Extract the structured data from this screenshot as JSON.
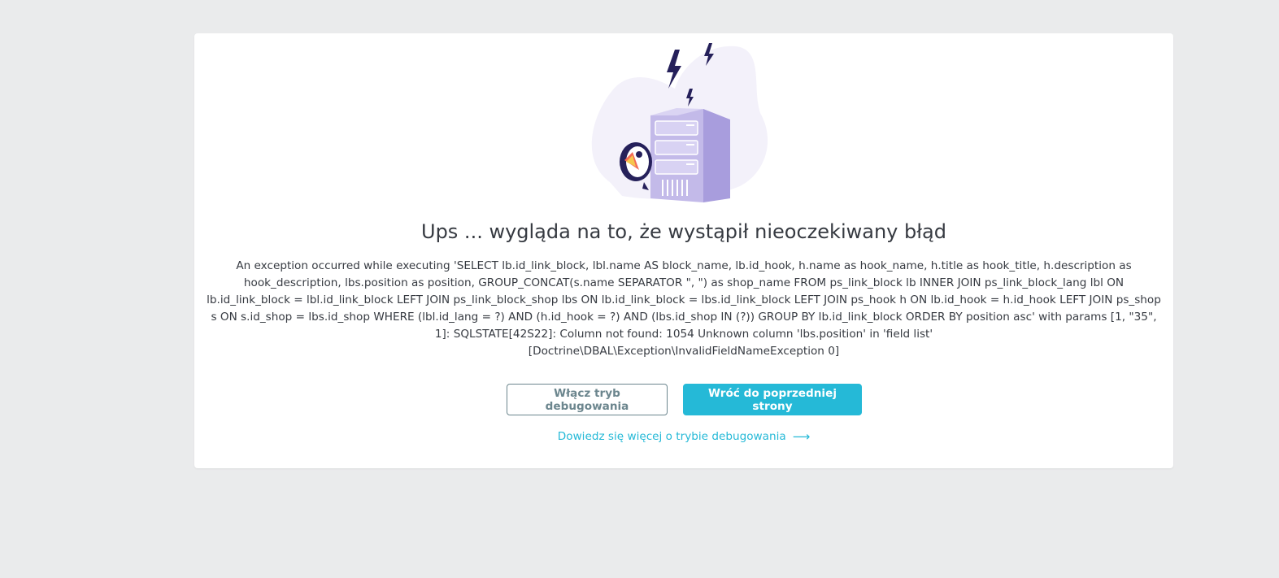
{
  "page": {
    "title": "Ups ... wygląda na to, że wystąpił nieoczekiwany błąd",
    "error_message": "An exception occurred while executing 'SELECT lb.id_link_block, lbl.name AS block_name, lb.id_hook, h.name as hook_name, h.title as hook_title, h.description as hook_description, lbs.position as position, GROUP_CONCAT(s.name SEPARATOR \", \") as shop_name FROM ps_link_block lb INNER JOIN ps_link_block_lang lbl ON lb.id_link_block = lbl.id_link_block LEFT JOIN ps_link_block_shop lbs ON lb.id_link_block = lbs.id_link_block LEFT JOIN ps_hook h ON lb.id_hook = h.id_hook LEFT JOIN ps_shop s ON s.id_shop = lbs.id_shop WHERE (lbl.id_lang = ?) AND (h.id_hook = ?) AND (lbs.id_shop IN (?)) GROUP BY lb.id_link_block ORDER BY position asc' with params [1, \"35\", 1]: SQLSTATE[42S22]: Column not found: 1054 Unknown column 'lbs.position' in 'field list'",
    "exception_class": "[Doctrine\\DBAL\\Exception\\InvalidFieldNameException 0]"
  },
  "actions": {
    "debug_button": "Włącz tryb debugowania",
    "back_button": "Wróć do poprzedniej strony",
    "learn_more_link": "Dowiedz się więcej o trybie debugowania",
    "learn_more_icon": "arrow-right-icon"
  },
  "colors": {
    "accent": "#25b9d7",
    "outline": "#6c868e",
    "text": "#363a41",
    "background": "#eaebec",
    "illustration_primary": "#bdb5e8",
    "illustration_dark": "#25205a"
  }
}
